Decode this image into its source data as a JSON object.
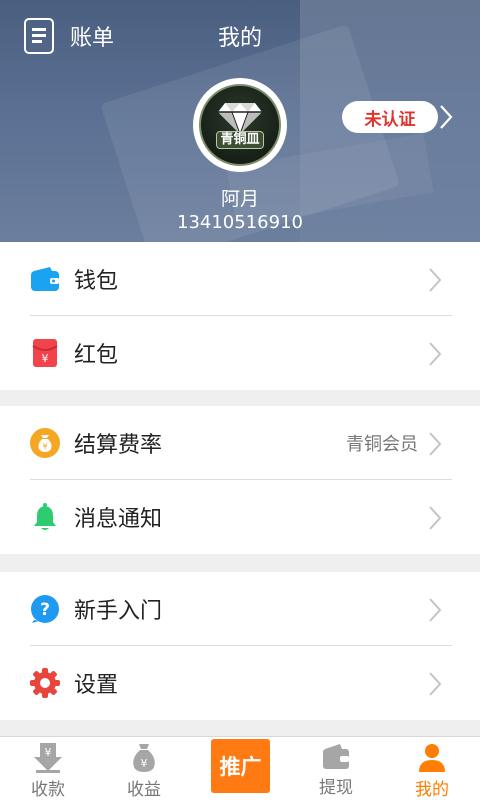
{
  "header": {
    "bill_label": "账单",
    "title": "我的",
    "verify_label": "未认证",
    "level_badge": "青铜皿",
    "user_name": "阿月",
    "user_phone": "13410516910"
  },
  "menu": {
    "group1": [
      {
        "label": "钱包",
        "icon": "wallet-icon"
      },
      {
        "label": "红包",
        "icon": "red-packet-icon"
      }
    ],
    "group2": [
      {
        "label": "结算费率",
        "value": "青铜会员",
        "icon": "money-bag-icon"
      },
      {
        "label": "消息通知",
        "icon": "bell-icon"
      }
    ],
    "group3": [
      {
        "label": "新手入门",
        "icon": "question-icon"
      },
      {
        "label": "设置",
        "icon": "gear-icon"
      }
    ]
  },
  "tabbar": {
    "tabs": [
      {
        "label": "收款",
        "icon": "receive-icon"
      },
      {
        "label": "收益",
        "icon": "income-bag-icon"
      },
      {
        "label": "推广",
        "icon": "promote"
      },
      {
        "label": "提现",
        "icon": "withdraw-wallet-icon"
      },
      {
        "label": "我的",
        "icon": "profile-icon"
      }
    ],
    "active_index": 4
  },
  "colors": {
    "accent": "#ff7d00",
    "verify_text": "#e0332b",
    "wallet": "#19a3f0",
    "red_packet": "#f2434b",
    "money_bag": "#f5a623",
    "bell": "#2ecc71",
    "question": "#1e9bf0",
    "gear": "#e8453c"
  }
}
